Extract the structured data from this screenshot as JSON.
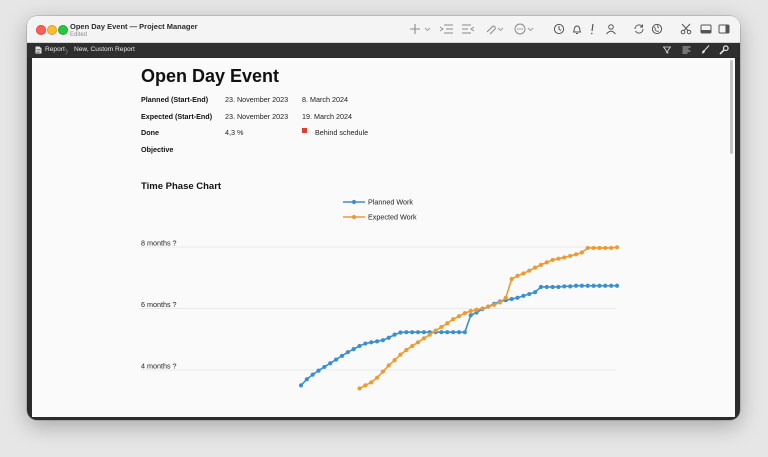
{
  "window": {
    "title": "Open Day Event — Project Manager",
    "subtitle": "Edited"
  },
  "toolbar_icons": [
    "plus-icon",
    "indent-icon",
    "outdent-icon",
    "link-icon",
    "more-circle-icon",
    "clock-icon",
    "bell-icon",
    "priority-icon",
    "person-icon",
    "sync-icon",
    "globe-icon",
    "scissors-icon",
    "bottom-panel-icon",
    "right-panel-icon"
  ],
  "breadcrumb": {
    "root": "Report",
    "separator": "〉",
    "current": "New, Custom Report"
  },
  "report": {
    "title": "Open Day Event",
    "rows": [
      {
        "label": "Planned (Start-End)",
        "start": "23. November 2023",
        "end": "8. March 2024"
      },
      {
        "label": "Expected (Start-End)",
        "start": "23. November 2023",
        "end": "19. March 2024"
      },
      {
        "label": "Done",
        "start": "4,3 %",
        "end": "Behind schedule"
      },
      {
        "label": "Objective",
        "start": "",
        "end": ""
      }
    ],
    "status_color": "#d93f2f"
  },
  "section_title": "Time Phase Chart",
  "chart_data": {
    "type": "line",
    "title": "",
    "xlabel": "",
    "ylabel": "",
    "y_tick_labels": [
      {
        "value": 8,
        "label": "8 months ?"
      },
      {
        "value": 6,
        "label": "6 months ?"
      },
      {
        "value": 4,
        "label": "4 months ?"
      }
    ],
    "ylim_visible": [
      3.45,
      9.1
    ],
    "grid": true,
    "legend_position": "top-center",
    "x": [
      0,
      1,
      2,
      3,
      4,
      5,
      6,
      7,
      8,
      9,
      10,
      11,
      12,
      13,
      14,
      15,
      16,
      17,
      18,
      19,
      20,
      21,
      22,
      23,
      24,
      25,
      26,
      27,
      28,
      29,
      30,
      31,
      32,
      33,
      34,
      35,
      36,
      37,
      38,
      39,
      40,
      41,
      42,
      43,
      44,
      45,
      46,
      47,
      48,
      49,
      50,
      51,
      52,
      53,
      54
    ],
    "series": [
      {
        "name": "Planned Work",
        "color": "#3b8fd0",
        "values": [
          3.5,
          3.7,
          3.85,
          3.98,
          4.1,
          4.22,
          4.34,
          4.46,
          4.58,
          4.68,
          4.78,
          4.86,
          4.9,
          4.93,
          4.97,
          5.05,
          5.15,
          5.22,
          5.23,
          5.23,
          5.23,
          5.23,
          5.23,
          5.23,
          5.23,
          5.23,
          5.23,
          5.23,
          5.23,
          5.78,
          5.87,
          5.98,
          6.06,
          6.15,
          6.23,
          6.27,
          6.31,
          6.35,
          6.41,
          6.47,
          6.53,
          6.7,
          6.7,
          6.7,
          6.7,
          6.72,
          6.72,
          6.74,
          6.74,
          6.74,
          6.74,
          6.74,
          6.74,
          6.74,
          6.74
        ]
      },
      {
        "name": "Expected Work",
        "color": "#ef9a2f",
        "values": [
          null,
          null,
          null,
          null,
          null,
          null,
          null,
          null,
          null,
          null,
          3.4,
          3.5,
          3.6,
          3.75,
          3.95,
          4.15,
          4.32,
          4.5,
          4.65,
          4.78,
          4.9,
          5.03,
          5.15,
          5.28,
          5.4,
          5.52,
          5.65,
          5.75,
          5.85,
          5.92,
          5.96,
          6.0,
          6.06,
          6.12,
          6.2,
          6.35,
          6.96,
          7.06,
          7.14,
          7.23,
          7.33,
          7.42,
          7.5,
          7.58,
          7.62,
          7.66,
          7.71,
          7.76,
          7.82,
          7.97,
          7.97,
          7.97,
          7.97,
          7.97,
          7.99
        ]
      }
    ]
  }
}
